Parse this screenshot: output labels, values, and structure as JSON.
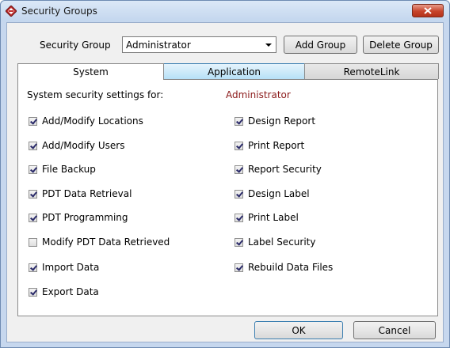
{
  "window": {
    "title": "Security Groups"
  },
  "header": {
    "group_label": "Security Group",
    "group_value": "Administrator",
    "add_group_label": "Add Group",
    "delete_group_label": "Delete Group"
  },
  "tabs": [
    {
      "label": "System",
      "state": "selected"
    },
    {
      "label": "Application",
      "state": "hover"
    },
    {
      "label": "RemoteLink",
      "state": "normal"
    }
  ],
  "panel": {
    "heading": "System security settings for:",
    "group_name": "Administrator",
    "left_column": [
      {
        "label": "Add/Modify Locations",
        "checked": true
      },
      {
        "label": "Add/Modify Users",
        "checked": true
      },
      {
        "label": "File Backup",
        "checked": true
      },
      {
        "label": "PDT Data Retrieval",
        "checked": true
      },
      {
        "label": "PDT Programming",
        "checked": true
      },
      {
        "label": "Modify PDT Data Retrieved",
        "checked": false
      },
      {
        "label": "Import Data",
        "checked": true
      },
      {
        "label": "Export Data",
        "checked": true
      }
    ],
    "right_column": [
      {
        "label": "Design Report",
        "checked": true
      },
      {
        "label": "Print Report",
        "checked": true
      },
      {
        "label": "Report Security",
        "checked": true
      },
      {
        "label": "Design Label",
        "checked": true
      },
      {
        "label": "Print Label",
        "checked": true
      },
      {
        "label": "Label Security",
        "checked": true
      },
      {
        "label": "Rebuild Data Files",
        "checked": true
      }
    ]
  },
  "footer": {
    "ok_label": "OK",
    "cancel_label": "Cancel"
  },
  "colors": {
    "accent_text": "#8b1a1a",
    "hover_tab": "#b6e0f7",
    "close_button": "#c7442b"
  }
}
